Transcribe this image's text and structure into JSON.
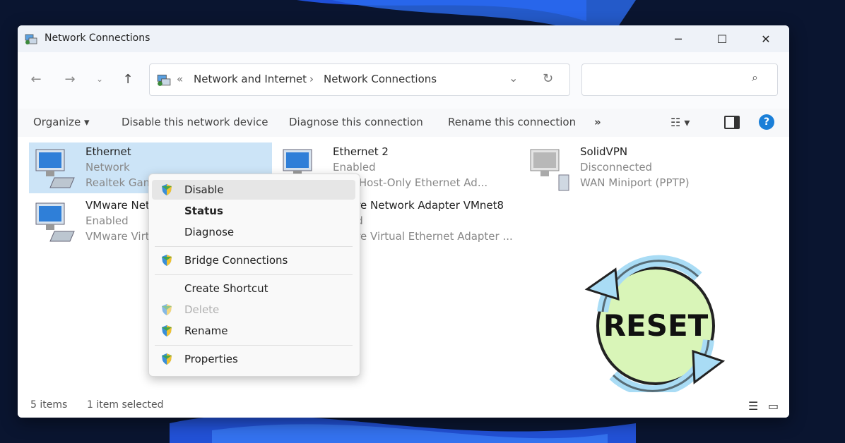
{
  "window": {
    "title": "Network Connections"
  },
  "address": {
    "crumb1": "Network and Internet",
    "sep": "›",
    "crumb2": "Network Connections",
    "prefix": "«"
  },
  "search": {
    "placeholder": ""
  },
  "commands": {
    "organize": "Organize",
    "disable": "Disable this network device",
    "diagnose": "Diagnose this connection",
    "rename": "Rename this connection",
    "more": "»"
  },
  "items": [
    {
      "name": "Ethernet",
      "status": "Network",
      "device": "Realtek Gam"
    },
    {
      "name": "Ethernet 2",
      "status": "Enabled",
      "device": "lBox Host-Only Ethernet Ad..."
    },
    {
      "name": "SolidVPN",
      "status": "Disconnected",
      "device": "WAN Miniport (PPTP)"
    },
    {
      "name": "VMware Net",
      "status": "Enabled",
      "device": "VMware Virt"
    },
    {
      "name": "are Network Adapter VMnet8",
      "status": "ed",
      "device": "are Virtual Ethernet Adapter ..."
    }
  ],
  "context_menu": {
    "disable": "Disable",
    "status": "Status",
    "diagnose": "Diagnose",
    "bridge": "Bridge Connections",
    "shortcut": "Create Shortcut",
    "delete": "Delete",
    "rename": "Rename",
    "properties": "Properties"
  },
  "statusbar": {
    "count": "5 items",
    "selected": "1 item selected"
  },
  "overlay": {
    "reset_text": "RESET"
  },
  "colors": {
    "selection": "#cce4f7",
    "accent": "#0078d4",
    "reset_green": "#d9f5b8",
    "reset_arrows": "#a9dcf5"
  },
  "icons": [
    "back-icon",
    "forward-icon",
    "recent-icon",
    "up-icon",
    "network-folder-icon",
    "chevron-down-icon",
    "refresh-icon",
    "search-icon",
    "view-options-icon",
    "preview-pane-icon",
    "help-icon",
    "shield-icon",
    "network-adapter-icon",
    "details-view-icon",
    "tiles-view-icon",
    "minimize-icon",
    "maximize-icon",
    "close-icon"
  ]
}
